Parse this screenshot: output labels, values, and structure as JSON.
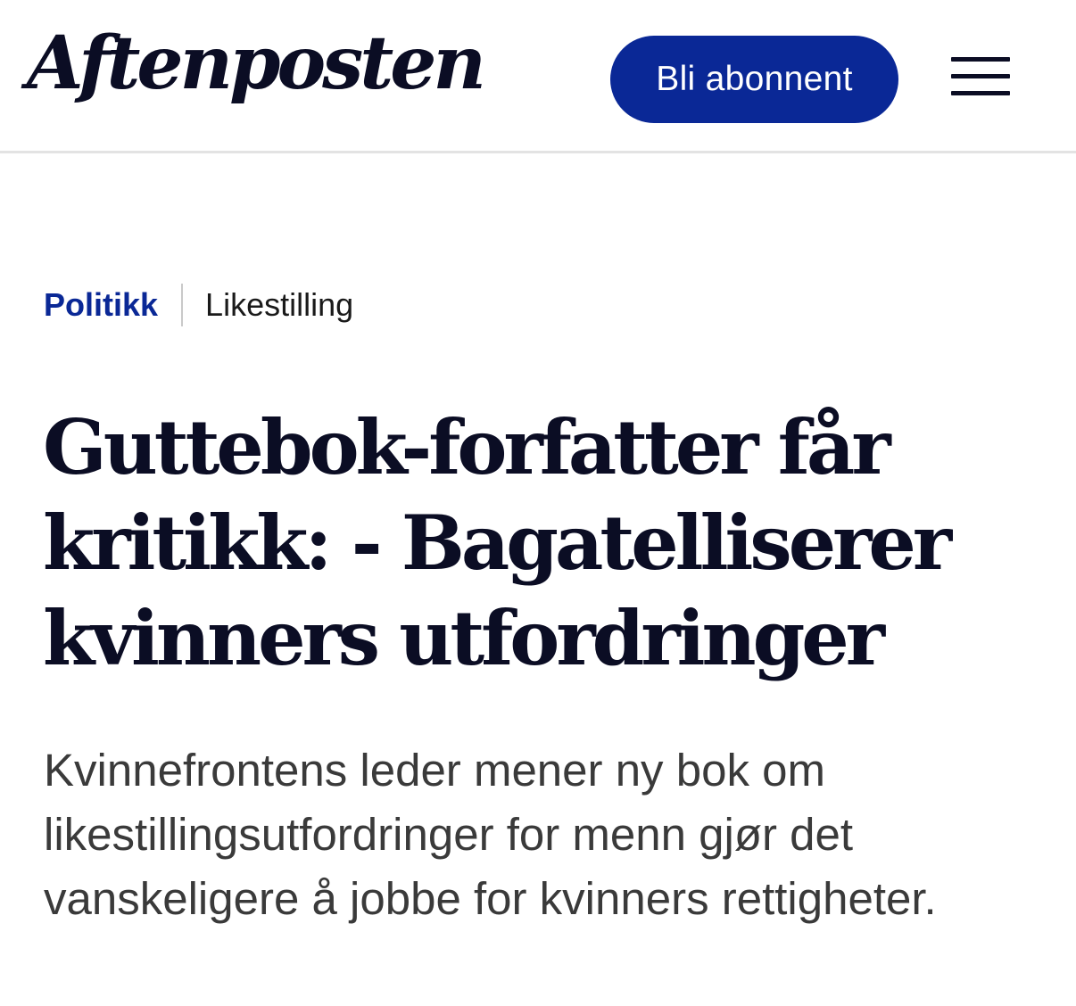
{
  "header": {
    "logo_text": "Aftenposten",
    "subscribe_label": "Bli abonnent",
    "menu_icon": "hamburger-menu-icon"
  },
  "breadcrumb": {
    "section": "Politikk",
    "topic": "Likestilling"
  },
  "article": {
    "headline": "Guttebok-forfatter får kritikk: - Bagatelliserer kvinners utfordringer",
    "lead": "Kvinnefrontens leder mener ny bok om likestillingsutfordringer for menn gjør det vanskeligere å jobbe for kvinners rettigheter."
  },
  "colors": {
    "brand_blue": "#0a2896",
    "text_dark": "#0b0d24",
    "lead_gray": "#3a3a3a",
    "divider": "#e3e3e3"
  }
}
